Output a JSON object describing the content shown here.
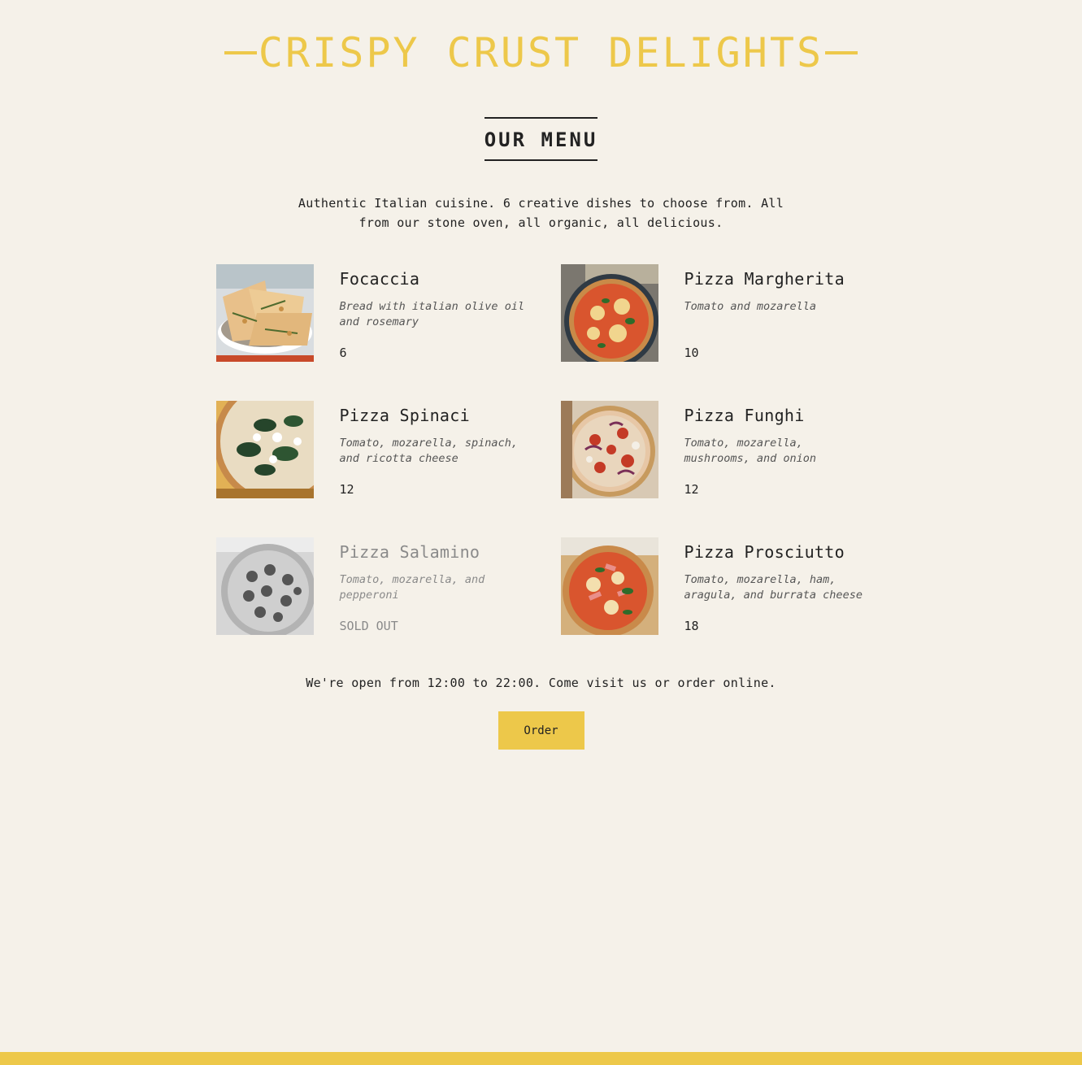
{
  "colors": {
    "background": "#f5f1e9",
    "accent": "#edc84a",
    "text": "#222222",
    "muted": "#8a8a8a"
  },
  "header": {
    "brand": "CRISPY CRUST DELIGHTS"
  },
  "menu": {
    "heading": "OUR MENU",
    "intro": "Authentic Italian cuisine. 6 creative dishes to choose from. All from our stone oven, all organic, all delicious.",
    "items": [
      {
        "name": "Focaccia",
        "description": "Bread with italian olive oil and rosemary",
        "price": "6",
        "image": "focaccia-photo"
      },
      {
        "name": "Pizza Margherita",
        "description": "Tomato and mozarella",
        "price": "10",
        "image": "margherita-photo"
      },
      {
        "name": "Pizza Spinaci",
        "description": "Tomato, mozarella, spinach, and ricotta cheese",
        "price": "12",
        "image": "spinaci-photo"
      },
      {
        "name": "Pizza Funghi",
        "description": "Tomato, mozarella, mushrooms, and onion",
        "price": "12",
        "image": "funghi-photo"
      },
      {
        "name": "Pizza Salamino",
        "description": "Tomato, mozarella, and pepperoni",
        "price": "SOLD OUT",
        "image": "salamino-photo",
        "sold_out": true
      },
      {
        "name": "Pizza Prosciutto",
        "description": "Tomato, mozarella, ham, aragula, and burrata cheese",
        "price": "18",
        "image": "prosciutto-photo"
      }
    ]
  },
  "footer": {
    "hours": "We're open from 12:00 to 22:00. Come visit us or order online.",
    "order_label": "Order"
  }
}
